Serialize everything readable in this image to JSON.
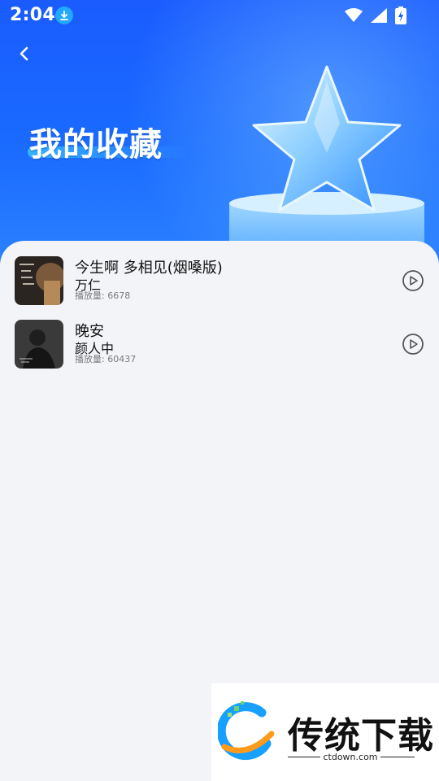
{
  "status_bar": {
    "time": "2:04"
  },
  "header": {
    "title": "我的收藏"
  },
  "songs": [
    {
      "title": "今生啊 多相见(烟嗓版)",
      "artist": "万仁",
      "plays": "播放量: 6678"
    },
    {
      "title": "晚安",
      "artist": "颜人中",
      "plays": "播放量: 60437"
    }
  ],
  "watermark": {
    "name": "传统下载",
    "url": "ctdown.com"
  },
  "colors": {
    "header_blue": "#1a5cff",
    "sheet_bg": "#f3f4f8"
  },
  "icons": [
    "download-icon",
    "wifi-icon",
    "signal-icon",
    "battery-icon",
    "back-arrow-icon",
    "star-icon",
    "play-icon"
  ]
}
